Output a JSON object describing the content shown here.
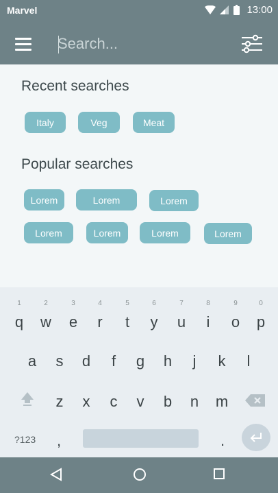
{
  "status_bar": {
    "carrier": "Marvel",
    "time": "13:00"
  },
  "app_bar": {
    "search_placeholder": "Search..."
  },
  "recent": {
    "title": "Recent searches",
    "chips": [
      "Italy",
      "Veg",
      "Meat"
    ]
  },
  "popular": {
    "title": "Popular searches",
    "chips": [
      "Lorem",
      "Lorem",
      "Lorem",
      "Lorem",
      "Lorem",
      "Lorem",
      "Lorem"
    ]
  },
  "keyboard": {
    "row1": [
      "q",
      "w",
      "e",
      "r",
      "t",
      "y",
      "u",
      "i",
      "o",
      "p"
    ],
    "row1_nums": [
      "1",
      "2",
      "3",
      "4",
      "5",
      "6",
      "7",
      "8",
      "9",
      "0"
    ],
    "row2": [
      "a",
      "s",
      "d",
      "f",
      "g",
      "h",
      "j",
      "k",
      "l"
    ],
    "row3": [
      "z",
      "x",
      "c",
      "v",
      "b",
      "n",
      "m"
    ],
    "symbols_label": "?123",
    "comma": ",",
    "period": "."
  },
  "colors": {
    "bar": "#6e8287",
    "chip": "#7fbcc6",
    "background": "#f3f7f8",
    "keyboard": "#e9eef2"
  }
}
